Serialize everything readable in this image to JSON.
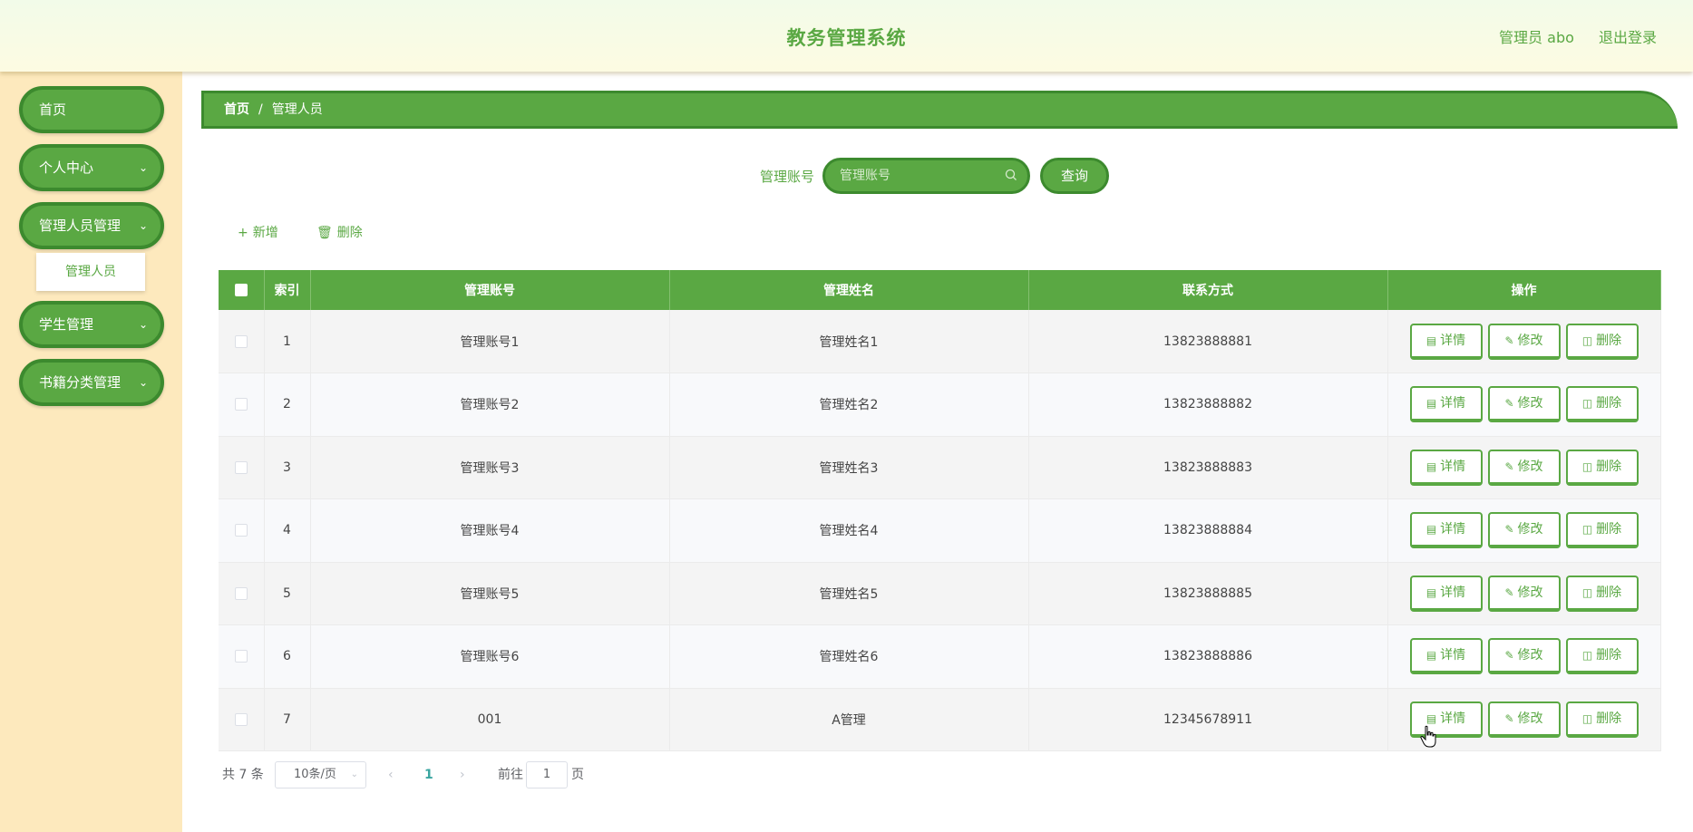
{
  "header": {
    "title": "教务管理系统",
    "user": "管理员 abo",
    "logout": "退出登录"
  },
  "sidebar": {
    "items": [
      {
        "label": "首页",
        "has_arrow": false
      },
      {
        "label": "个人中心",
        "has_arrow": true
      },
      {
        "label": "管理人员管理",
        "has_arrow": true
      },
      {
        "label": "学生管理",
        "has_arrow": true
      },
      {
        "label": "书籍分类管理",
        "has_arrow": true
      }
    ],
    "submenu": {
      "label": "管理人员"
    }
  },
  "breadcrumb": {
    "home": "首页",
    "sep": "/",
    "current": "管理人员"
  },
  "search": {
    "label": "管理账号",
    "placeholder": "管理账号",
    "button": "查询"
  },
  "toolbar": {
    "add": "新增",
    "delete": "删除"
  },
  "table": {
    "columns": [
      "索引",
      "管理账号",
      "管理姓名",
      "联系方式",
      "操作"
    ],
    "rows": [
      {
        "index": "1",
        "account": "管理账号1",
        "name": "管理姓名1",
        "phone": "13823888881"
      },
      {
        "index": "2",
        "account": "管理账号2",
        "name": "管理姓名2",
        "phone": "13823888882"
      },
      {
        "index": "3",
        "account": "管理账号3",
        "name": "管理姓名3",
        "phone": "13823888883"
      },
      {
        "index": "4",
        "account": "管理账号4",
        "name": "管理姓名4",
        "phone": "13823888884"
      },
      {
        "index": "5",
        "account": "管理账号5",
        "name": "管理姓名5",
        "phone": "13823888885"
      },
      {
        "index": "6",
        "account": "管理账号6",
        "name": "管理姓名6",
        "phone": "13823888886"
      },
      {
        "index": "7",
        "account": "001",
        "name": "A管理",
        "phone": "12345678911"
      }
    ],
    "actions": {
      "detail": "详情",
      "edit": "修改",
      "delete": "删除"
    }
  },
  "pagination": {
    "total": "共 7 条",
    "page_size": "10条/页",
    "current_page": "1",
    "goto_prefix": "前往",
    "goto_value": "1",
    "goto_suffix": "页"
  },
  "colors": {
    "primary": "#5aa843",
    "primary_dark": "#3c8a2e",
    "sidebar_bg": "#fde9bd"
  }
}
